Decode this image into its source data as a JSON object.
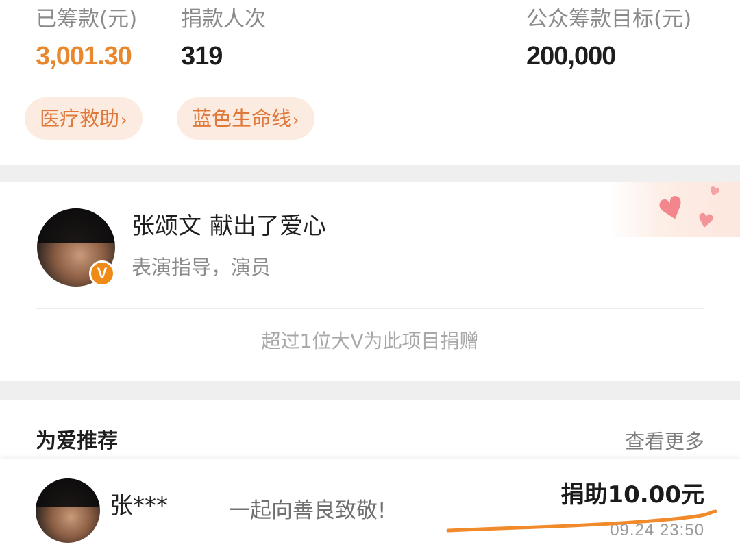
{
  "stats": {
    "raised_label": "已筹款(元)",
    "raised_value": "3,001.30",
    "donors_label": "捐款人次",
    "donors_value": "319",
    "goal_label": "公众筹款目标(元)",
    "goal_value": "200,000"
  },
  "tags": [
    {
      "label": "医疗救助",
      "chevron": "›"
    },
    {
      "label": "蓝色生命线",
      "chevron": "›"
    }
  ],
  "celebrity": {
    "name": "张颂文",
    "action": "献出了爱心",
    "title": "表演指导，演员",
    "badge": "V",
    "note": "超过1位大V为此项目捐赠"
  },
  "recommend": {
    "title": "为爱推荐",
    "more": "查看更多"
  },
  "record": {
    "donor": "张***",
    "message": "一起向善良致敬!",
    "amount": "捐助10.00元",
    "time": "09.24 23:50"
  },
  "colors": {
    "accent_orange": "#e8872c",
    "tag_bg": "#fcebe0",
    "tag_text": "#e0783a",
    "badge_orange": "#f08a16",
    "underline_orange": "#f08a2a",
    "heart_pink": "#f2868c"
  },
  "icons": [
    "verified-v-icon",
    "heart-icon",
    "chevron-right-icon"
  ]
}
